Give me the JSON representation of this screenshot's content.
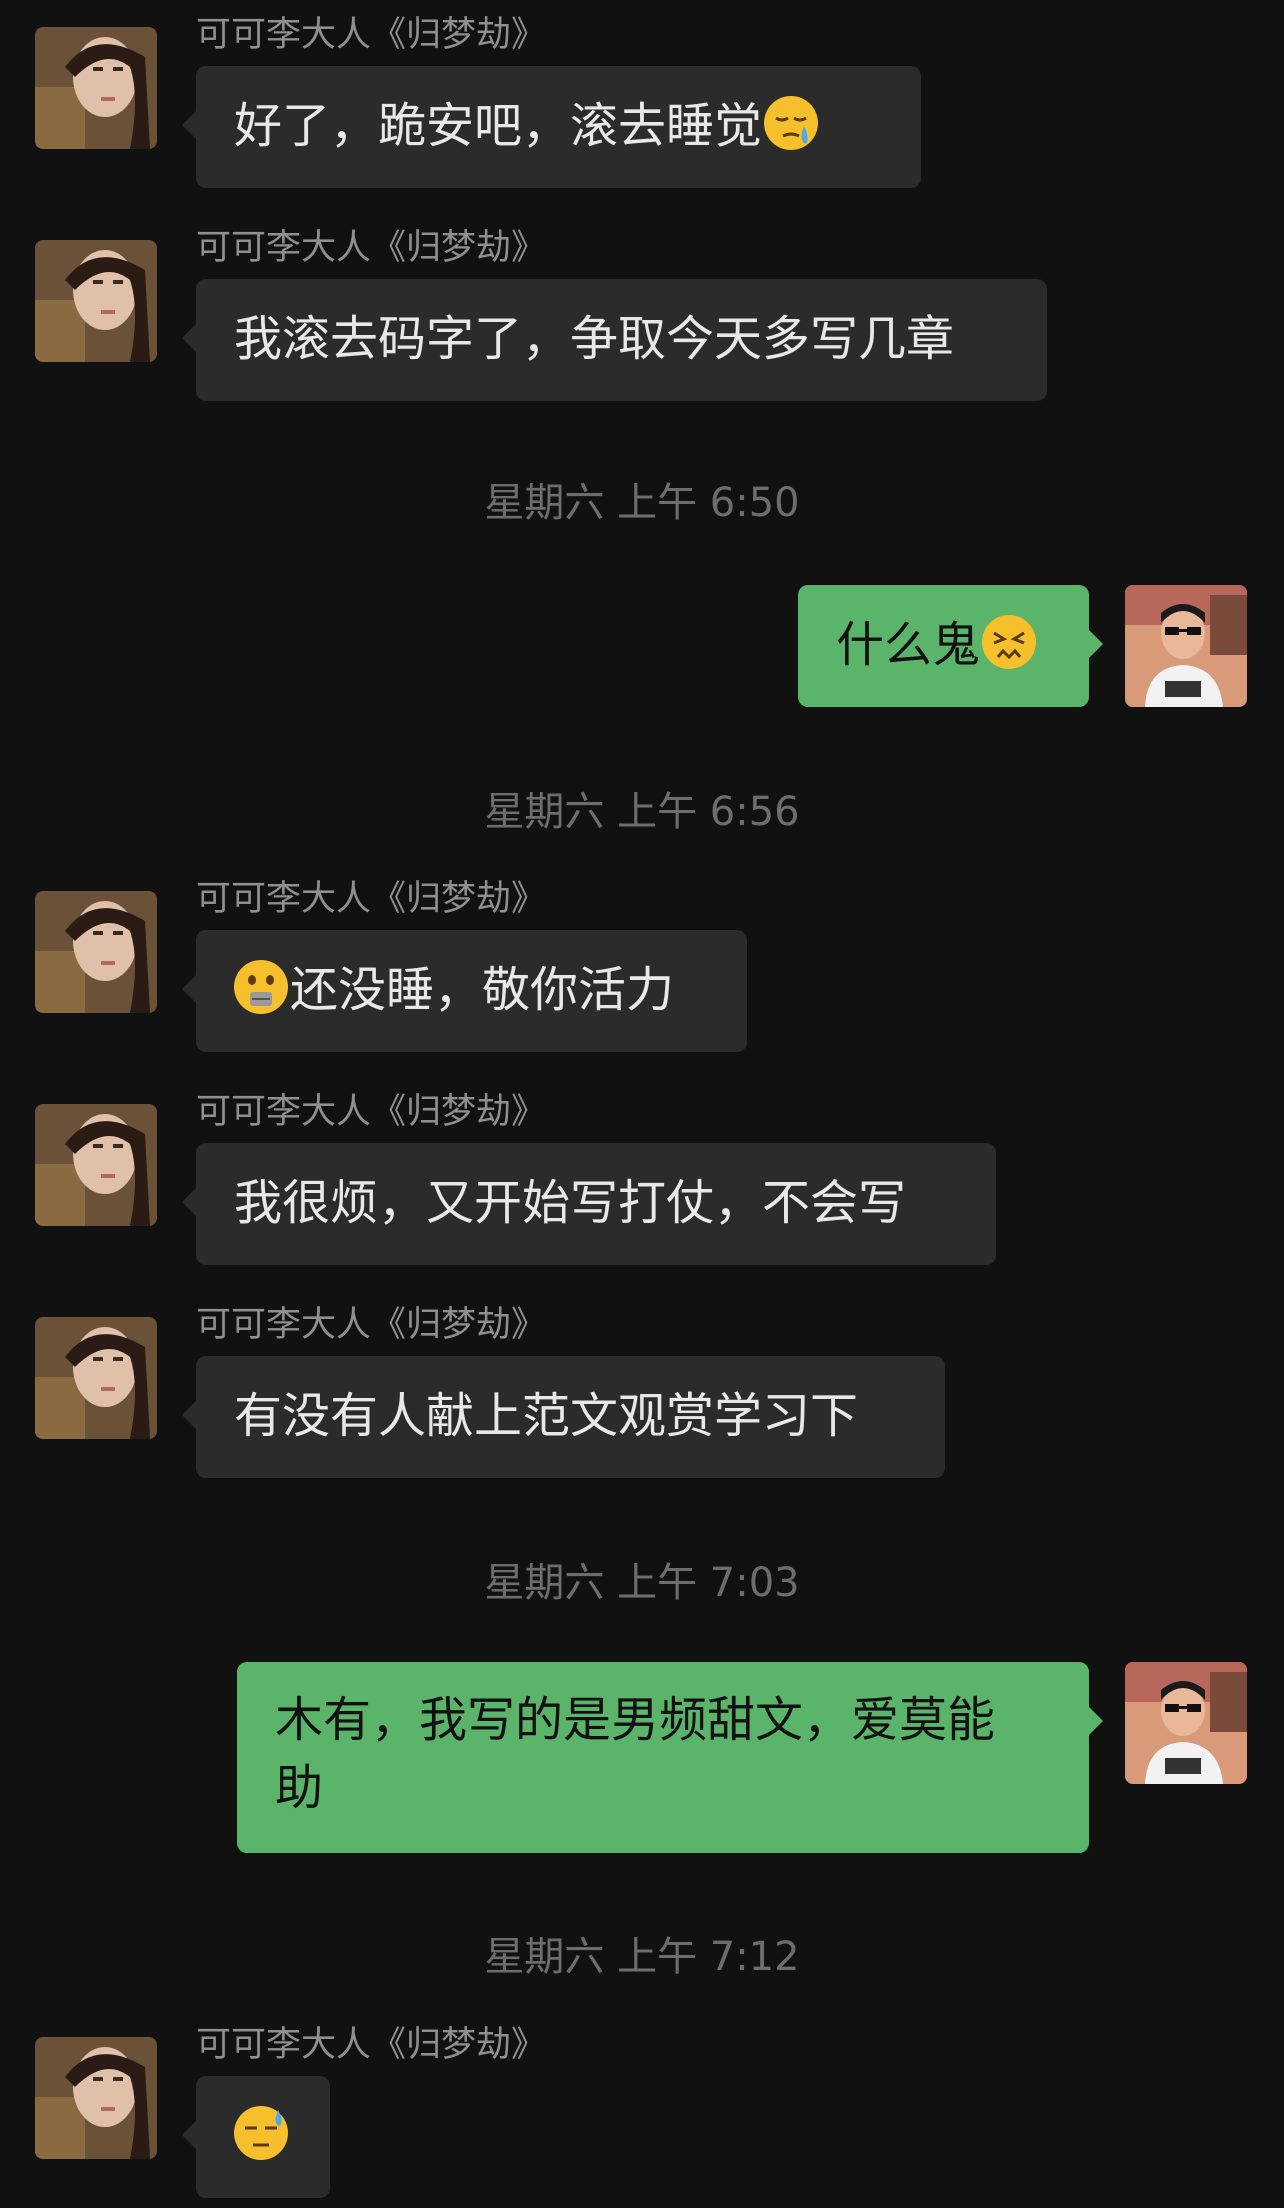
{
  "messages": [
    {
      "sender": "可可李大人《归梦劫》",
      "text_before": "好了，跪安吧，滚去睡觉",
      "emoji": "sleepy-face-icon"
    },
    {
      "sender": "可可李大人《归梦劫》",
      "text": "我滚去码字了，争取今天多写几章"
    },
    {
      "timestamp": "星期六 上午 6:50"
    },
    {
      "text": "什么鬼",
      "emoji": "confounded-face-icon"
    },
    {
      "timestamp": "星期六 上午 6:56"
    },
    {
      "sender": "可可李大人《归梦劫》",
      "emoji": "zipper-mouth-face-icon",
      "text": "还没睡，敬你活力"
    },
    {
      "sender": "可可李大人《归梦劫》",
      "text": "我很烦，又开始写打仗，不会写"
    },
    {
      "sender": "可可李大人《归梦劫》",
      "text": "有没有人献上范文观赏学习下"
    },
    {
      "timestamp": "星期六 上午 7:03"
    },
    {
      "line1": "木有，我写的是男频甜文，爱莫能",
      "line2": "助"
    },
    {
      "timestamp": "星期六 上午 7:12"
    },
    {
      "sender": "可可李大人《归梦劫》",
      "emoji": "downcast-face-with-sweat-icon"
    }
  ],
  "colors": {
    "background": "#111111",
    "incoming_bubble": "#2b2b2b",
    "outgoing_bubble": "#5ab46a",
    "sender_name": "#8f8f8f",
    "timestamp": "#6d6d6d"
  }
}
